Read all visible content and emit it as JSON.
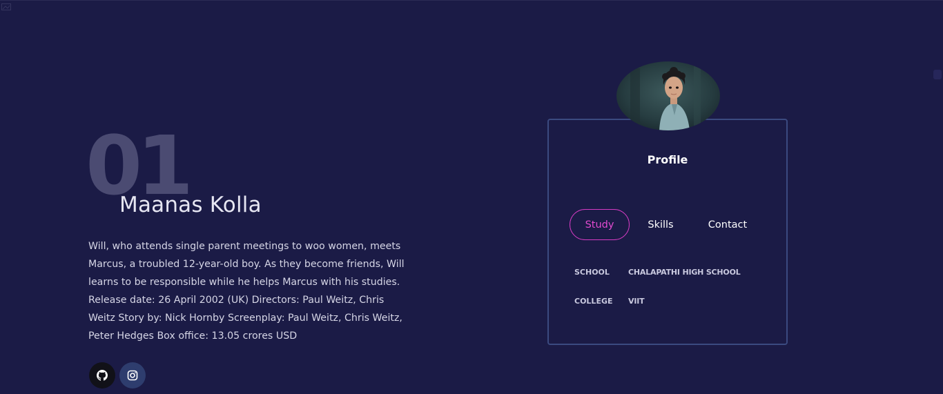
{
  "hero": {
    "number": "01",
    "name": "Maanas Kolla",
    "bio": "Will, who attends single parent meetings to woo women, meets Marcus, a troubled 12-year-old boy. As they become friends, Will learns to be responsible while he helps Marcus with his studies. Release date: 26 April 2002 (UK) Directors: Paul Weitz, Chris Weitz Story by: Nick Hornby Screenplay: Paul Weitz, Chris Weitz, Peter Hedges Box office: 13.05 crores USD"
  },
  "socials": [
    {
      "icon": "github-icon"
    },
    {
      "icon": "instagram-icon"
    }
  ],
  "profile": {
    "title": "Profile",
    "tabs": [
      {
        "label": "Study",
        "active": true
      },
      {
        "label": "Skills",
        "active": false
      },
      {
        "label": "Contact",
        "active": false
      }
    ],
    "study": [
      {
        "key": "SCHOOL",
        "value": "CHALAPATHI HIGH SCHOOL"
      },
      {
        "key": "COLLEGE",
        "value": "VIIT"
      }
    ]
  },
  "colors": {
    "background": "#1b1b46",
    "accent": "#d63cc4",
    "card_border": "#3b4a80"
  }
}
